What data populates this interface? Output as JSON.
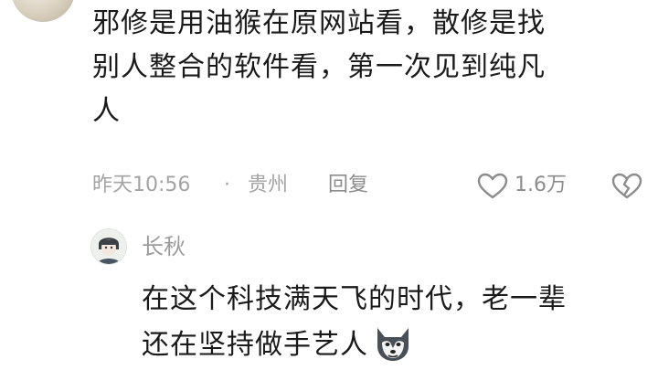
{
  "comment": {
    "text_lines": [
      "邪修是用油猴在原网站看，散修是找",
      "别人整合的软件看，第一次见到纯凡",
      "人"
    ],
    "time": "昨天10:56",
    "separator": "·",
    "location": "贵州",
    "reply_label": "回复",
    "like_count": "1.6万",
    "like_icon": "heart-outline-icon",
    "dislike_icon": "broken-heart-icon"
  },
  "reply": {
    "username": "长秋",
    "text_lines": [
      "在这个科技满天飞的时代，老一辈",
      "还在坚持做手艺人"
    ],
    "emoji": "wolf-face-emoji"
  },
  "colors": {
    "text_primary": "#1a1a1a",
    "text_meta": "#a3a3a3",
    "icon_gray": "#8c8c8c"
  }
}
